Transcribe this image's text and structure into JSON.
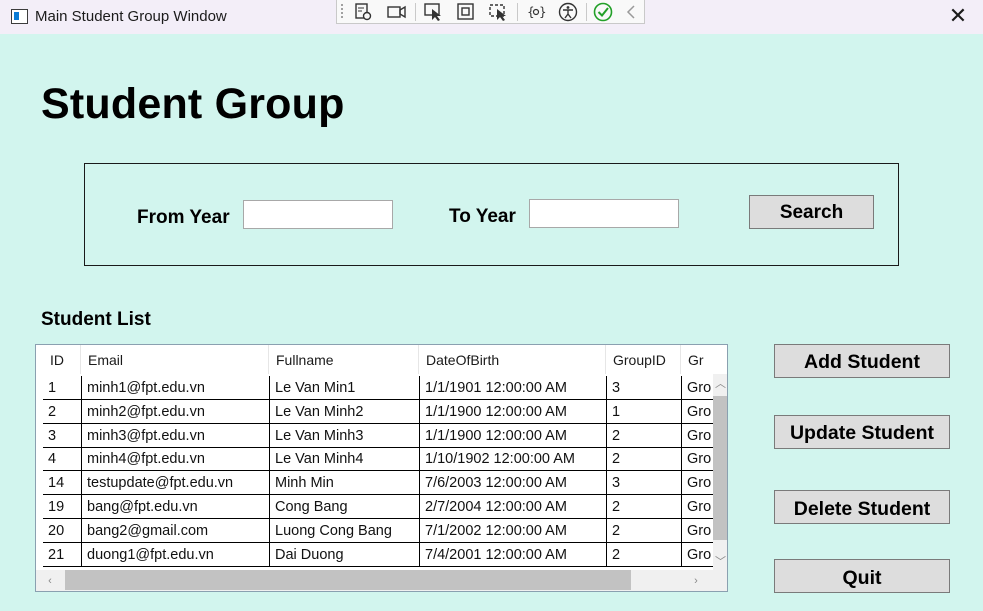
{
  "window": {
    "title": "Main Student Group Window",
    "close_glyph": "✕"
  },
  "devtools": {
    "icons": [
      "live-visual-tree-icon",
      "track-focus-icon",
      "select-element-icon",
      "display-layout-adorners-icon",
      "preview-selection-icon",
      "binding-failures-icon",
      "accessibility-icon",
      "checkmark-icon",
      "collapse-chevron-icon"
    ]
  },
  "header": {
    "title": "Student Group"
  },
  "filter": {
    "from_year_label": "From Year",
    "from_year_value": "",
    "to_year_label": "To Year",
    "to_year_value": "",
    "search_label": "Search"
  },
  "student_list": {
    "label": "Student List",
    "columns": [
      "ID",
      "Email",
      "Fullname",
      "DateOfBirth",
      "GroupID",
      "Gr"
    ],
    "rows": [
      [
        "1",
        "minh1@fpt.edu.vn",
        "Le Van Min1",
        "1/1/1901 12:00:00 AM",
        "3",
        "Gro"
      ],
      [
        "2",
        "minh2@fpt.edu.vn",
        "Le Van Minh2",
        "1/1/1900 12:00:00 AM",
        "1",
        "Gro"
      ],
      [
        "3",
        "minh3@fpt.edu.vn",
        "Le Van Minh3",
        "1/1/1900 12:00:00 AM",
        "2",
        "Gro"
      ],
      [
        "4",
        "minh4@fpt.edu.vn",
        "Le Van Minh4",
        "1/10/1902 12:00:00 AM",
        "2",
        "Gro"
      ],
      [
        "14",
        "testupdate@fpt.edu.vn",
        "Minh Min",
        "7/6/2003 12:00:00 AM",
        "3",
        "Gro"
      ],
      [
        "19",
        "bang@fpt.edu.vn",
        "Cong Bang",
        "2/7/2004 12:00:00 AM",
        "2",
        "Gro"
      ],
      [
        "20",
        "bang2@gmail.com",
        "Luong Cong Bang",
        "7/1/2002 12:00:00 AM",
        "2",
        "Gro"
      ],
      [
        "21",
        "duong1@fpt.edu.vn",
        "Dai Duong",
        "7/4/2001 12:00:00 AM",
        "2",
        "Gro"
      ]
    ]
  },
  "actions": {
    "add": "Add Student",
    "update": "Update Student",
    "delete": "Delete Student",
    "quit": "Quit"
  },
  "colors": {
    "background": "#d2f5ee",
    "button": "#dddddd",
    "title_bar": "#f3eef8"
  }
}
